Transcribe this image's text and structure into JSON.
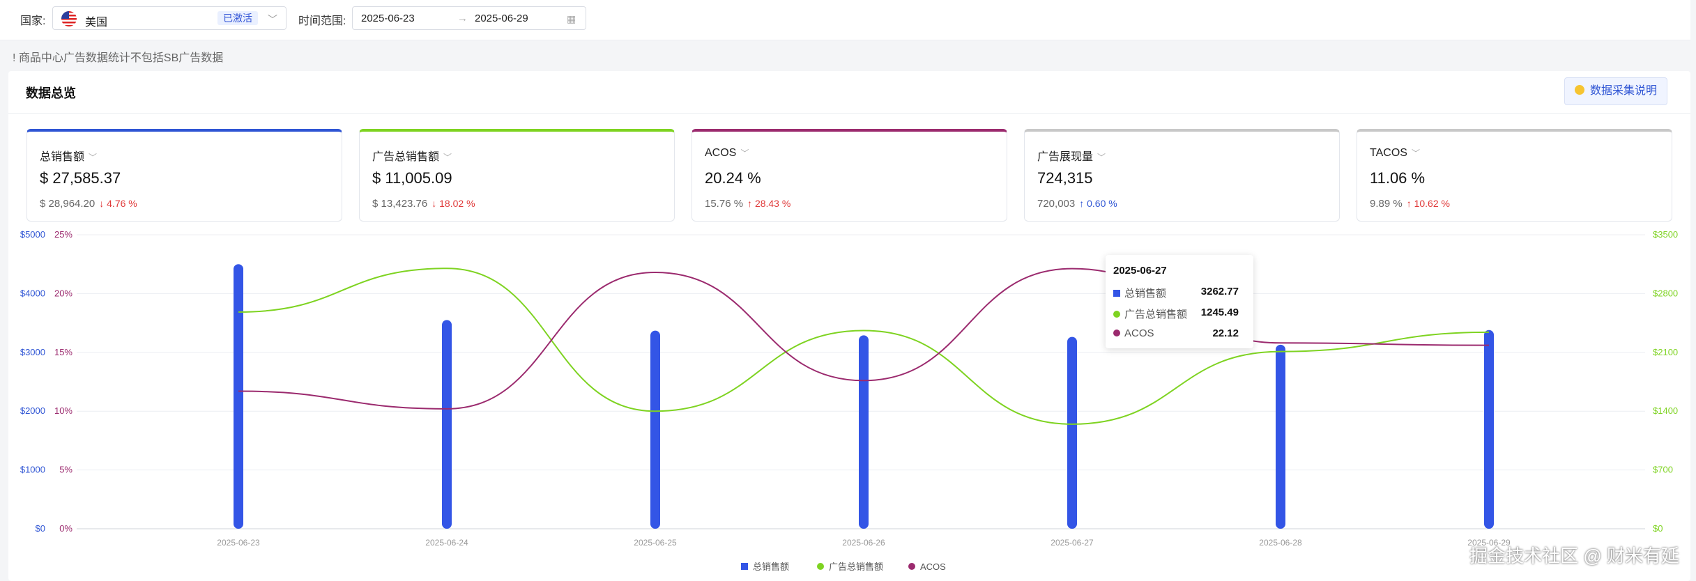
{
  "filters": {
    "country_label": "国家:",
    "country_value": "美国",
    "country_status": "已激活",
    "range_label": "时间范围:",
    "start_date": "2025-06-23",
    "end_date": "2025-06-29"
  },
  "notice": "! 商品中心广告数据统计不包括SB广告数据",
  "overview": {
    "title": "数据总览",
    "help_label": "数据采集说明"
  },
  "metrics": [
    {
      "label": "总销售额",
      "value": "$ 27,585.37",
      "prev": "$ 28,964.20",
      "change": "4.76 %",
      "arrow": "↓",
      "accent": "#2f55d4"
    },
    {
      "label": "广告总销售额",
      "value": "$ 11,005.09",
      "prev": "$ 13,423.76",
      "change": "18.02 %",
      "arrow": "↓",
      "accent": "#7ed321"
    },
    {
      "label": "ACOS",
      "value": "20.24 %",
      "prev": "15.76 %",
      "change": "28.43 %",
      "arrow": "↑",
      "accent": "#9b2a6e"
    },
    {
      "label": "广告展现量",
      "value": "724,315",
      "prev": "720,003",
      "change": "0.60 %",
      "arrow": "↑",
      "accent": "#c8c8c8"
    },
    {
      "label": "TACOS",
      "value": "11.06 %",
      "prev": "9.89 %",
      "change": "10.62 %",
      "arrow": "↑",
      "accent": "#c8c8c8"
    }
  ],
  "chart_data": {
    "type": "bar",
    "categories": [
      "2025-06-23",
      "2025-06-24",
      "2025-06-25",
      "2025-06-26",
      "2025-06-27",
      "2025-06-28",
      "2025-06-29"
    ],
    "series": [
      {
        "name": "总销售额",
        "type": "bar",
        "axis": "left_sales",
        "color": "#3355e6",
        "values": [
          4500,
          3550,
          3370,
          3290,
          3262.77,
          3130,
          3380
        ]
      },
      {
        "name": "广告总销售额",
        "type": "line",
        "axis": "right_ad_sales",
        "color": "#7ed321",
        "values": [
          2580,
          3100,
          1400,
          2360,
          1245.49,
          2110,
          2340
        ]
      },
      {
        "name": "ACOS",
        "type": "line",
        "axis": "left_acos",
        "color": "#9b2a6e",
        "values": [
          11.7,
          10.2,
          21.8,
          12.6,
          22.12,
          15.8,
          15.6
        ]
      }
    ],
    "axes": {
      "left_sales": {
        "ticks": [
          "$0",
          "$1000",
          "$2000",
          "$3000",
          "$4000",
          "$5000"
        ],
        "range": [
          0,
          5000
        ],
        "color": "#2f55d4"
      },
      "left_acos": {
        "ticks": [
          "0%",
          "5%",
          "10%",
          "15%",
          "20%",
          "25%"
        ],
        "range": [
          0,
          25
        ],
        "color": "#9b2a6e"
      },
      "right_ad_sales": {
        "ticks": [
          "$0",
          "$700",
          "$1400",
          "$2100",
          "$2800",
          "$3500"
        ],
        "range": [
          0,
          3500
        ],
        "color": "#7ed321"
      }
    },
    "grid": true,
    "legend": "bottom-center",
    "tooltip": {
      "date": "2025-06-27",
      "rows": [
        {
          "name": "总销售额",
          "value": "3262.77",
          "color": "#3355e6",
          "shape": "square"
        },
        {
          "name": "广告总销售额",
          "value": "1245.49",
          "color": "#7ed321",
          "shape": "circle"
        },
        {
          "name": "ACOS",
          "value": "22.12",
          "color": "#9b2a6e",
          "shape": "circle"
        }
      ]
    }
  },
  "watermark": "掘金技术社区 @ 财米有延"
}
